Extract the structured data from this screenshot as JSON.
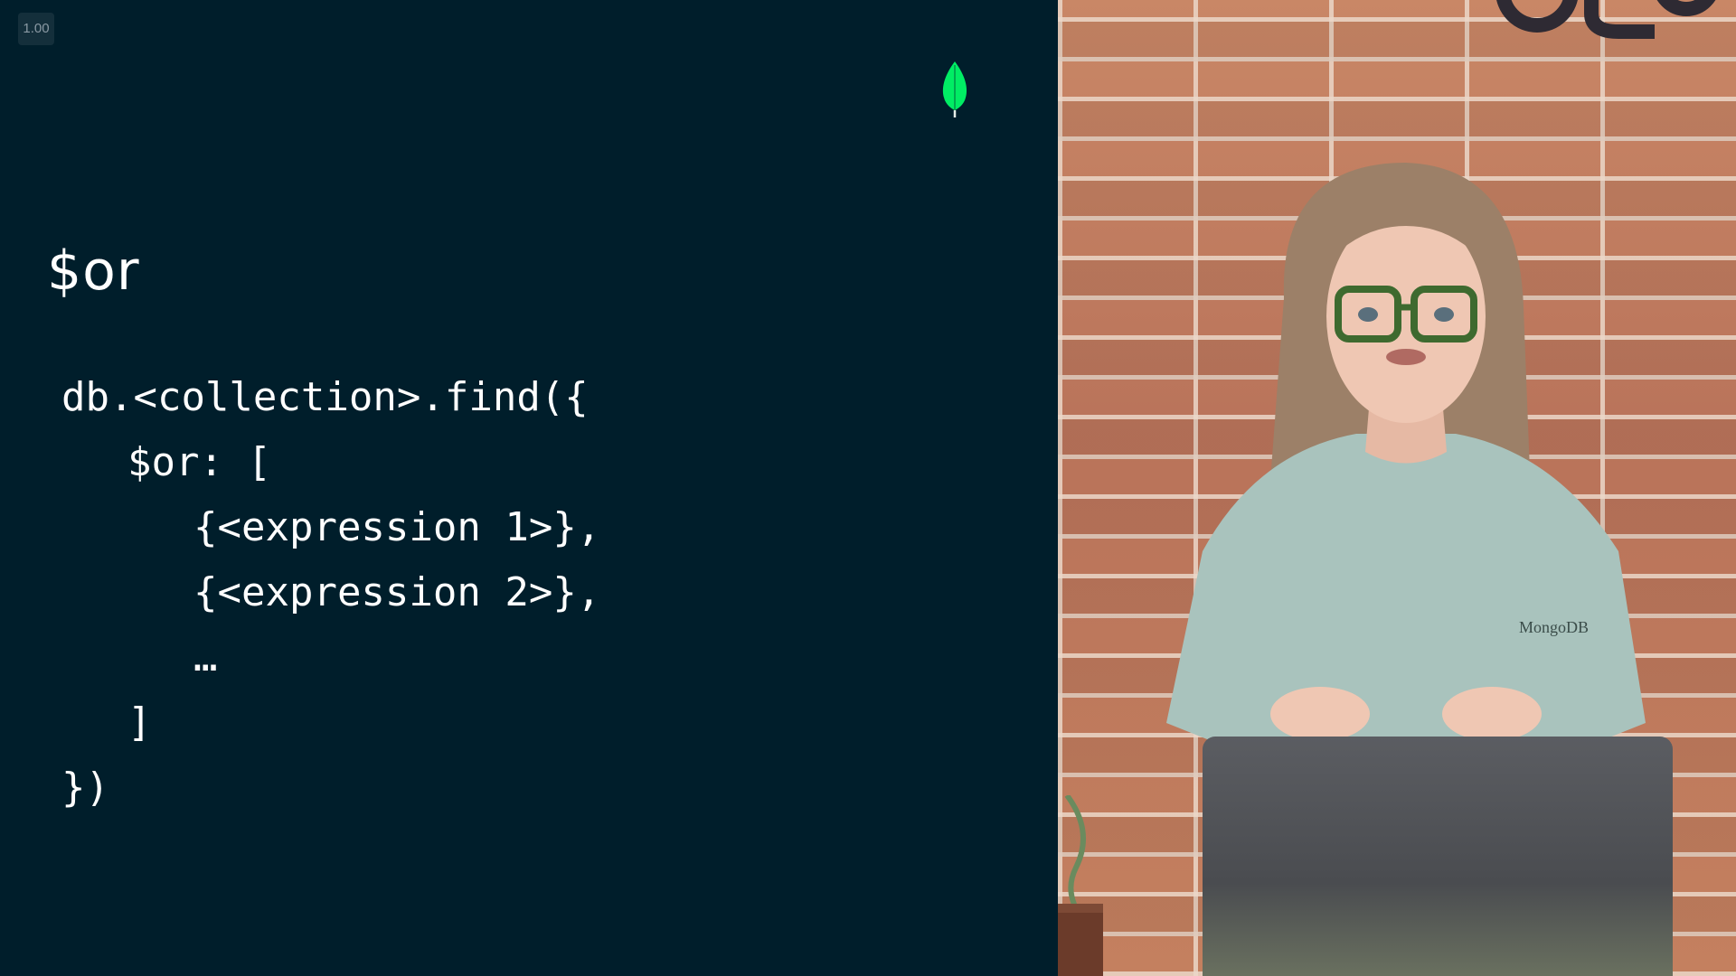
{
  "player": {
    "speed_label": "1.00"
  },
  "slide": {
    "background_color": "#001e2b",
    "logo_icon": "mongodb-leaf-icon",
    "logo_color": "#00ed64",
    "title": "$or",
    "code_lines": [
      {
        "text": "db.<collection>.find({",
        "indent": 0
      },
      {
        "text": "$or: [",
        "indent": 1
      },
      {
        "text": "{<expression 1>},",
        "indent": 2
      },
      {
        "text": "{<expression 2>},",
        "indent": 2
      },
      {
        "text": "…",
        "indent": 2
      },
      {
        "text": "]",
        "indent": 1
      },
      {
        "text": "})",
        "indent": 0
      }
    ]
  },
  "video": {
    "shirt_logo_text": "MongoDB",
    "presenter_icon": "presenter-video-icon"
  }
}
